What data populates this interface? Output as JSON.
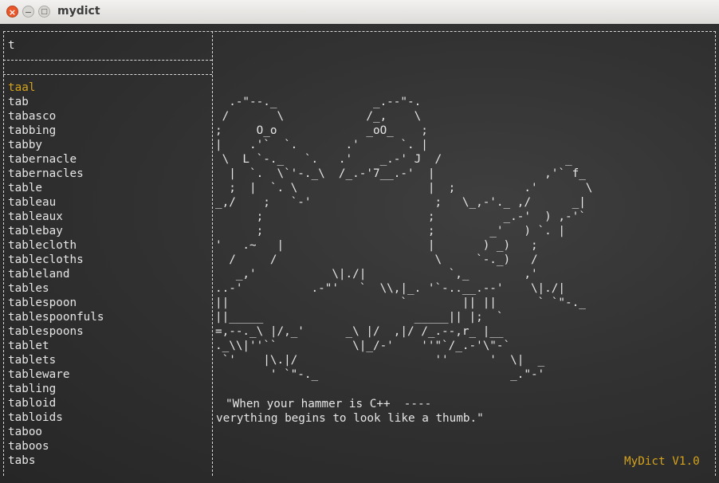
{
  "window": {
    "title": "mydict",
    "close_glyph": "×",
    "minimize_glyph": "−",
    "maximize_glyph": "□"
  },
  "search": {
    "value": "t"
  },
  "word_list": {
    "selected": "taal",
    "rest": "tab\ntabasco\ntabbing\ntabby\ntabernacle\ntabernacles\ntable\ntableau\ntableaux\ntablebay\ntablecloth\ntablecloths\ntableland\ntables\ntablespoon\ntablespoonfuls\ntablespoons\ntablet\ntablets\ntableware\ntabling\ntabloid\ntabloids\ntaboo\ntaboos\ntabs"
  },
  "art": {
    "ascii": "  .-\"--._              _.--\"-.\n /       \\            /_,    \\\n;     O_o             _oO_    ;\n|    .'`  `.       .'      `. |\n \\  L `-._   `.   .'    _.-' J  /                  _\n  |  `.  \\`'-._\\  /_.-'7__.-'  |                ,'` f_\n  ;  |  `. \\                   |  ;          .'       \\\n_,/    ;   `-'                  ;   \\_,-'._ ,/      _|\n      ;                        ;          _.-'  ) ,-'`\n      ;                        ;        _'   ) `. |\n'   .~   |                     |       ) _)   ;\n  /     /                       \\     `-._)   /\n   _,'           \\|./|            `,_        ,'\n..-'          .-\"'   `  \\\\,|_. '`-..__.--'    \\|./|\n||                         `        || ||      ` `\"-._\n||_____                      _____|| |;  `\n=,--._\\ |/,_'      _\\ |/  ,|/ /_.--,r_ |__\n._\\\\|''``           \\|_/-'    ''\"`/_.-'\\\"-`\n `'    |\\.|/                    ''      '  \\|  _\n        ' `\"-._                            _.\"-'"
  },
  "quote": {
    "line1": "\"When your hammer is C++  ----",
    "line2": "verything begins to look like a thumb.\""
  },
  "footer": {
    "version": "MyDict V1.0"
  },
  "colors": {
    "background": "#2f2f2f",
    "text": "#e6e6e6",
    "accent": "#d4a21a"
  }
}
